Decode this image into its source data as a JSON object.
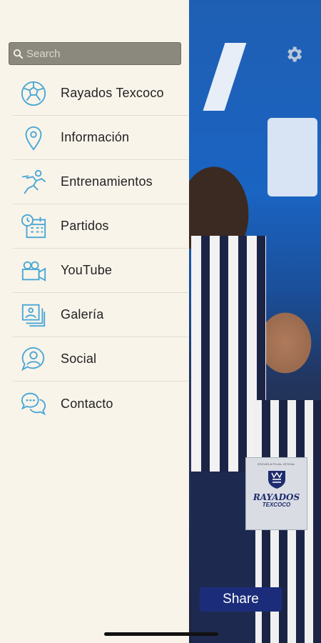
{
  "search": {
    "placeholder": "Search"
  },
  "menu": {
    "items": [
      {
        "label": "Rayados Texcoco",
        "icon": "soccer-ball-icon"
      },
      {
        "label": "Información",
        "icon": "location-pin-icon"
      },
      {
        "label": "Entrenamientos",
        "icon": "athlete-icon"
      },
      {
        "label": "Partidos",
        "icon": "calendar-clock-icon"
      },
      {
        "label": "YouTube",
        "icon": "video-camera-icon"
      },
      {
        "label": "Galería",
        "icon": "photo-gallery-icon"
      },
      {
        "label": "Social",
        "icon": "social-user-icon"
      },
      {
        "label": "Contacto",
        "icon": "chat-bubbles-icon"
      }
    ]
  },
  "badge": {
    "top_text": "ESCUELA FILIAL OFICIAL",
    "brand": "RAYADOS",
    "sub": "TEXCOCO"
  },
  "share": {
    "label": "Share"
  },
  "colors": {
    "drawer_bg": "#f9f4ea",
    "icon": "#4aa8d6",
    "share_bg": "#1b2d7a",
    "search_bg": "#8b897e"
  }
}
